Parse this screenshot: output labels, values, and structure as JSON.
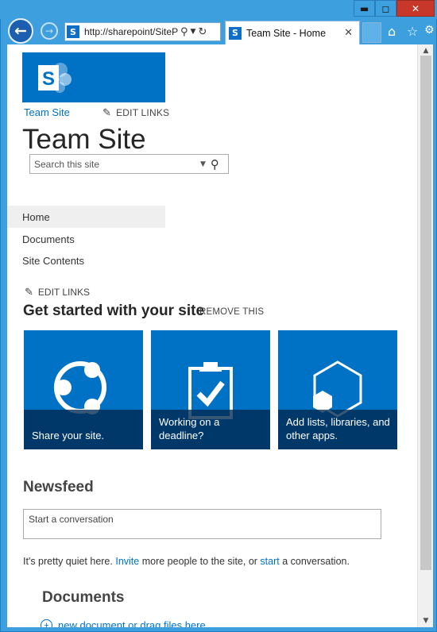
{
  "browser": {
    "address_url": "http://sharepoint/SiteP",
    "tab_title": "Team Site - Home",
    "window_controls": {
      "minimize": "▬",
      "maximize": "◻",
      "close": "✕"
    }
  },
  "site": {
    "logo_letter": "S",
    "site_link": "Team Site",
    "edit_links": "EDIT LINKS",
    "title": "Team Site",
    "search_placeholder": "Search this site"
  },
  "quick_launch": [
    {
      "label": "Home",
      "active": true
    },
    {
      "label": "Documents",
      "active": false
    },
    {
      "label": "Site Contents",
      "active": false
    }
  ],
  "get_started": {
    "edit_links": "EDIT LINKS",
    "heading": "Get started with your site",
    "remove_label": "REMOVE THIS",
    "tiles": [
      {
        "caption": "Share your site.",
        "icon": "share-icon"
      },
      {
        "caption": "Working on a deadline?",
        "icon": "clipboard-check-icon"
      },
      {
        "caption": "Add lists, libraries, and other apps.",
        "icon": "apps-hexagon-icon"
      }
    ]
  },
  "newsfeed": {
    "heading": "Newsfeed",
    "placeholder": "Start a conversation",
    "quiet_pre": "It's pretty quiet here. ",
    "invite_link": "Invite",
    "quiet_mid": " more people to the site, or ",
    "start_link": "start",
    "quiet_post": " a conversation."
  },
  "documents": {
    "heading": "Documents",
    "new_document": "new document or drag files here"
  },
  "colors": {
    "accent": "#0072c6",
    "chrome": "#3d9fde",
    "tile_caption_bg": "#00284f"
  }
}
